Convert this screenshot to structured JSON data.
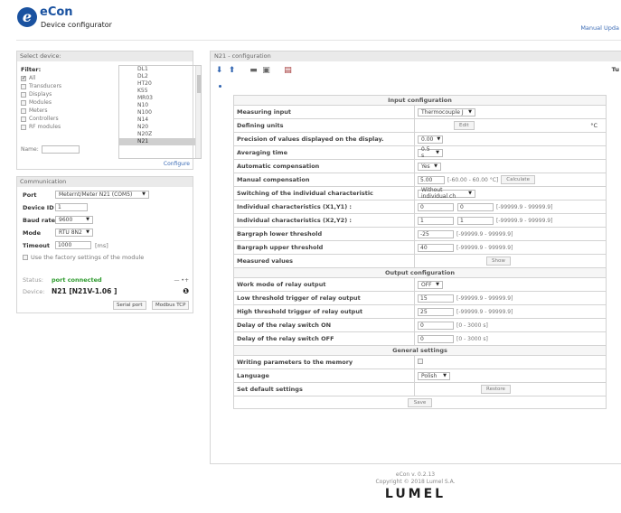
{
  "header": {
    "logo_letter": "e",
    "app_name": "eCon",
    "subtitle": "Device configurator",
    "manual_link": "Manual Upda"
  },
  "select_device": {
    "title": "Select device:",
    "filter_label": "Filter:",
    "filters": [
      {
        "label": "All",
        "checked": true
      },
      {
        "label": "Transducers",
        "checked": false
      },
      {
        "label": "Displays",
        "checked": false
      },
      {
        "label": "Modules",
        "checked": false
      },
      {
        "label": "Meters",
        "checked": false
      },
      {
        "label": "Controllers",
        "checked": false
      },
      {
        "label": "RF modules",
        "checked": false
      }
    ],
    "name_label": "Name:",
    "name_value": "",
    "devices": [
      "DL1",
      "DL2",
      "HT20",
      "K55",
      "MR03",
      "N10",
      "N100",
      "N14",
      "N20",
      "N20Z",
      "N21"
    ],
    "selected_device": "N21",
    "configure_link": "Configure"
  },
  "communication": {
    "title": "Communication",
    "port_label": "Port",
    "port_value": "Meternt/Meter N21 (COM5)",
    "device_id_label": "Device ID",
    "device_id_value": "1",
    "baud_label": "Baud rate",
    "baud_value": "9600",
    "mode_label": "Mode",
    "mode_value": "RTU 8N2",
    "timeout_label": "Timeout",
    "timeout_value": "1000",
    "timeout_unit": "[ms]",
    "factory_label": "Use the factory settings of the module",
    "status_label": "Status:",
    "status_value": "port connected",
    "status_icon": "plug-icon",
    "device_label": "Device:",
    "device_value": "N21 [N21V-1.06 ]",
    "serial_button": "Serial port",
    "modbus_button": "Modbus TCP"
  },
  "main": {
    "title": "N21 - configuration",
    "toolbar_right": "Tu",
    "sections": {
      "input": "Input configuration",
      "output": "Output configuration",
      "general": "General settings"
    },
    "rows": {
      "measuring_input": {
        "label": "Measuring input",
        "value": "Thermocouple J"
      },
      "defining_units": {
        "label": "Defining units",
        "button": "Edit",
        "unit": "°C"
      },
      "precision": {
        "label": "Precision of values displayed on the display.",
        "value": "0.00"
      },
      "averaging": {
        "label": "Averaging time",
        "value": "0.5 s"
      },
      "auto_comp": {
        "label": "Automatic compensation",
        "value": "Yes"
      },
      "manual_comp": {
        "label": "Manual compensation",
        "value": "5.00",
        "range": "[-60.00 - 60.00 °C]",
        "button": "Calculate"
      },
      "switching": {
        "label": "Switching of the individual characteristic",
        "value": "Without individual ch"
      },
      "ind_x1y1": {
        "label": "Individual characteristics (X1,Y1) :",
        "x": "0",
        "y": "0",
        "range": "[-99999.9 - 99999.9]"
      },
      "ind_x2y2": {
        "label": "Individual characteristics (X2,Y2) :",
        "x": "1",
        "y": "1",
        "range": "[-99999.9 - 99999.9]"
      },
      "bar_lower": {
        "label": "Bargraph lower threshold",
        "value": "-25",
        "range": "[-99999.9 - 99999.9]"
      },
      "bar_upper": {
        "label": "Bargraph upper threshold",
        "value": "40",
        "range": "[-99999.9 - 99999.9]"
      },
      "measured": {
        "label": "Measured values",
        "button": "Show"
      },
      "work_mode": {
        "label": "Work mode of relay output",
        "value": "OFF"
      },
      "low_trigger": {
        "label": "Low threshold trigger of relay output",
        "value": "15",
        "range": "[-99999.9 - 99999.9]"
      },
      "high_trigger": {
        "label": "High threshold trigger of relay output",
        "value": "25",
        "range": "[-99999.9 - 99999.9]"
      },
      "delay_on": {
        "label": "Delay of the relay switch ON",
        "value": "0",
        "range": "[0 - 3000 s]"
      },
      "delay_off": {
        "label": "Delay of the relay switch OFF",
        "value": "0",
        "range": "[0 - 3000 s]"
      },
      "writing": {
        "label": "Writing parameters to the memory"
      },
      "language": {
        "label": "Language",
        "value": "Polish"
      },
      "default": {
        "label": "Set default settings",
        "button": "Restore"
      }
    },
    "save_button": "Save"
  },
  "footer": {
    "version": "eCon v. 0.2.13",
    "copyright": "Copyright © 2018 Lumel S.A.",
    "brand": "LUMEL"
  }
}
